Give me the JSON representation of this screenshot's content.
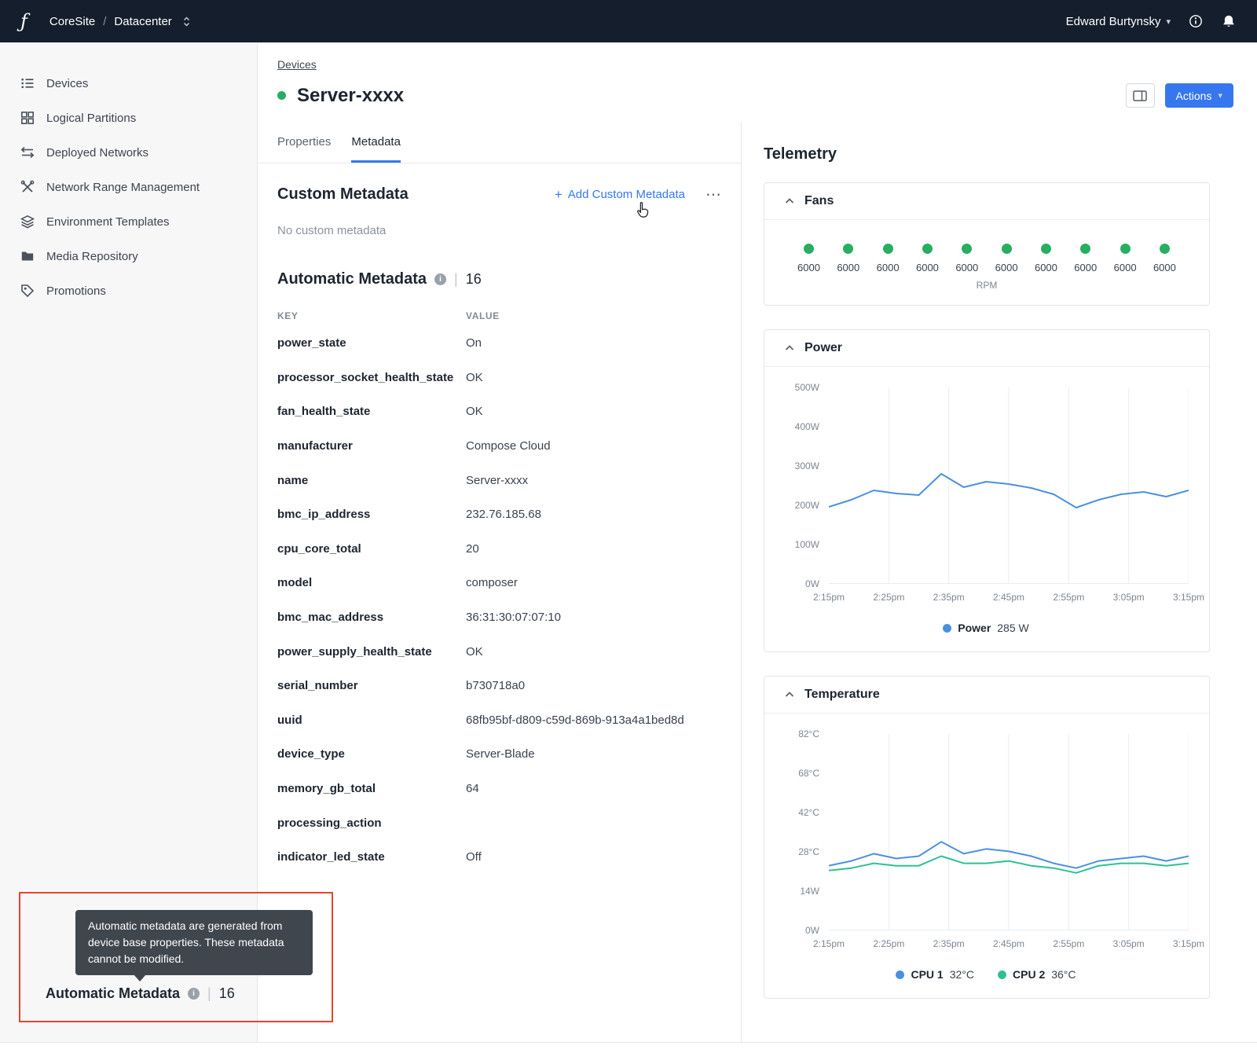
{
  "colors": {
    "accent_blue": "#3677f0",
    "status_green": "#27ae60",
    "chart_blue": "#4a90e2",
    "chart_green": "#2cc194",
    "annotation_red": "#e8432d",
    "topnav_bg": "#151e2c"
  },
  "icons": {
    "caret_down": "▾",
    "more": "⋯",
    "plus": "+",
    "pipe": "|",
    "info": "i"
  },
  "topnav": {
    "logo_glyph": "ƒ",
    "breadcrumb": {
      "org": "CoreSite",
      "separator": "/",
      "section": "Datacenter"
    },
    "user_name": "Edward Burtynsky"
  },
  "sidebar": {
    "items": [
      {
        "label": "Devices"
      },
      {
        "label": "Logical Partitions"
      },
      {
        "label": "Deployed Networks"
      },
      {
        "label": "Network Range Management"
      },
      {
        "label": "Environment Templates"
      },
      {
        "label": "Media Repository"
      },
      {
        "label": "Promotions"
      }
    ]
  },
  "page_header": {
    "back_link": "Devices",
    "title": "Server-xxxx",
    "actions_label": "Actions"
  },
  "tabs": {
    "properties": "Properties",
    "metadata": "Metadata"
  },
  "custom_metadata": {
    "title": "Custom Metadata",
    "add_button": "Add Custom Metadata",
    "empty_text": "No custom metadata"
  },
  "automatic_metadata": {
    "title": "Automatic Metadata",
    "count": "16",
    "key_header": "KEY",
    "value_header": "VALUE",
    "rows": [
      {
        "key": "power_state",
        "value": "On"
      },
      {
        "key": "processor_socket_health_state",
        "value": "OK"
      },
      {
        "key": "fan_health_state",
        "value": "OK"
      },
      {
        "key": "manufacturer",
        "value": "Compose Cloud"
      },
      {
        "key": "name",
        "value": "Server-xxxx"
      },
      {
        "key": "bmc_ip_address",
        "value": "232.76.185.68"
      },
      {
        "key": "cpu_core_total",
        "value": "20"
      },
      {
        "key": "model",
        "value": "composer"
      },
      {
        "key": "bmc_mac_address",
        "value": "36:31:30:07:07:10"
      },
      {
        "key": "power_supply_health_state",
        "value": "OK"
      },
      {
        "key": "serial_number",
        "value": "b730718a0"
      },
      {
        "key": "uuid",
        "value": "68fb95bf-d809-c59d-869b-913a4a1bed8d"
      },
      {
        "key": "device_type",
        "value": "Server-Blade"
      },
      {
        "key": "memory_gb_total",
        "value": "64"
      },
      {
        "key": "processing_action",
        "value": ""
      },
      {
        "key": "indicator_led_state",
        "value": "Off"
      }
    ]
  },
  "tooltip_callout": {
    "text": "Automatic metadata are generated from device base properties. These metadata cannot be modified.",
    "caption_title": "Automatic Metadata",
    "caption_count": "16"
  },
  "telemetry": {
    "title": "Telemetry",
    "fans": {
      "title": "Fans",
      "values": [
        "6000",
        "6000",
        "6000",
        "6000",
        "6000",
        "6000",
        "6000",
        "6000",
        "6000",
        "6000"
      ],
      "unit": "RPM"
    },
    "power": {
      "title": "Power"
    },
    "temperature": {
      "title": "Temperature"
    }
  },
  "chart_data": [
    {
      "type": "line",
      "title": "Power",
      "x_ticks": [
        "2:15pm",
        "2:25pm",
        "2:35pm",
        "2:45pm",
        "2:55pm",
        "3:05pm",
        "3:15pm"
      ],
      "y_ticks": [
        "500W",
        "400W",
        "300W",
        "200W",
        "100W",
        "0W"
      ],
      "ymin": 0,
      "ymax": 500,
      "grid": "vertical",
      "legend_position": "bottom",
      "series": [
        {
          "name": "Power",
          "color": "#4a90e2",
          "current": "285 W",
          "values": [
            196,
            214,
            238,
            230,
            226,
            280,
            246,
            260,
            254,
            244,
            228,
            194,
            214,
            228,
            234,
            222,
            238
          ]
        }
      ]
    },
    {
      "type": "line",
      "title": "Temperature",
      "x_ticks": [
        "2:15pm",
        "2:25pm",
        "2:35pm",
        "2:45pm",
        "2:55pm",
        "3:05pm",
        "3:15pm"
      ],
      "y_ticks": [
        "82°C",
        "68°C",
        "42°C",
        "28°C",
        "14W",
        "0W"
      ],
      "ymin": 0,
      "ymax": 82,
      "grid": "vertical",
      "legend_position": "bottom",
      "series": [
        {
          "name": "CPU 1",
          "color": "#4a90e2",
          "current": "32°C",
          "values": [
            27,
            29,
            32,
            30,
            31,
            37,
            32,
            34,
            33,
            31,
            28,
            26,
            29,
            30,
            31,
            29,
            31
          ]
        },
        {
          "name": "CPU 2",
          "color": "#2cc194",
          "current": "36°C",
          "values": [
            25,
            26,
            28,
            27,
            27,
            31,
            28,
            28,
            29,
            27,
            26,
            24,
            27,
            28,
            28,
            27,
            28
          ]
        }
      ]
    }
  ]
}
